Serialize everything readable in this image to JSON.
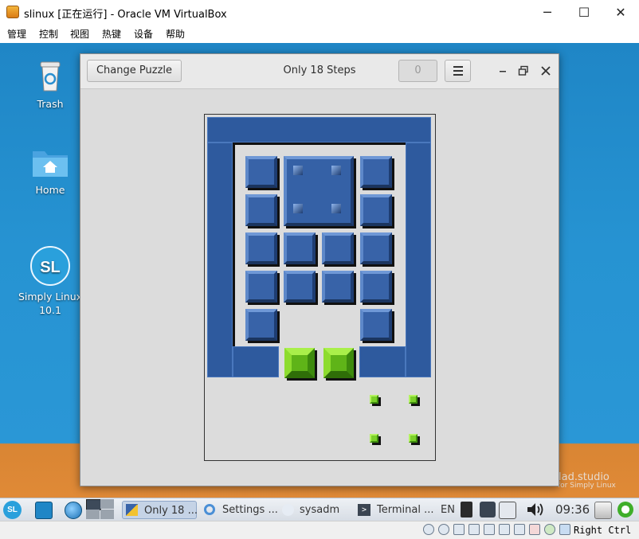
{
  "vbox": {
    "title": "slinux [正在运行] - Oracle VM VirtualBox",
    "menu": [
      "管理",
      "控制",
      "视图",
      "热键",
      "设备",
      "帮助"
    ],
    "status_host_key": "Right Ctrl"
  },
  "desktop": {
    "icons": [
      {
        "label": "Trash",
        "icon": "trash-icon"
      },
      {
        "label": "Home",
        "icon": "home-folder-icon"
      },
      {
        "label": "Simply Linux\n10.1",
        "icon": "simply-linux-logo"
      }
    ]
  },
  "app": {
    "change_button": "Change Puzzle",
    "title": "Only 18 Steps",
    "move_count": "0"
  },
  "taskbar": {
    "items": [
      "Only 18 ...",
      "Settings ...",
      "sysadm",
      "Terminal ..."
    ],
    "lang": "EN",
    "clock": "09:36"
  },
  "colors": {
    "desktop_sky": "#2693d2",
    "desktop_sand": "#e08a37",
    "block_blue": "#3863a8",
    "target_green": "#7bd12a"
  }
}
